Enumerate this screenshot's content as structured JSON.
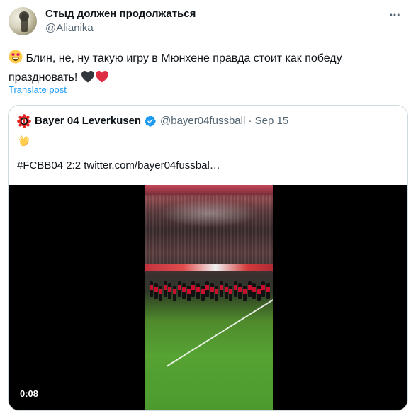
{
  "tweet": {
    "author": {
      "display_name": "Стыд должен продолжаться",
      "handle": "@Alianika"
    },
    "text": "Блин, не, ну такую игру в Мюнхене правда стоит как победу праздновать!",
    "emojis": [
      "smiling-face-with-heart-eyes",
      "black-heart",
      "red-heart"
    ],
    "translate_label": "Translate post",
    "menu_icon": "more-horizontal-icon"
  },
  "quoted_tweet": {
    "author": {
      "display_name": "Bayer 04 Leverkusen",
      "handle": "@bayer04fussball",
      "date": "Sep 15",
      "date_separator": "·",
      "verified": true
    },
    "emoji": "clapping-hands",
    "text": "#FCBB04 2:2  twitter.com/bayer04fussbal…",
    "video": {
      "timestamp": "0:08"
    }
  },
  "colors": {
    "text_primary": "#0f1419",
    "text_secondary": "#536471",
    "link": "#1d9bf0",
    "border": "#cfd9de",
    "bayer_red": "#e32221"
  }
}
